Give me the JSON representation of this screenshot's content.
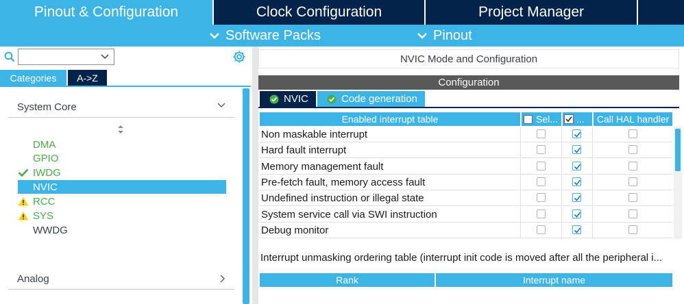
{
  "top_tabs": [
    {
      "label": "Pinout & Configuration",
      "active": true
    },
    {
      "label": "Clock Configuration",
      "active": false
    },
    {
      "label": "Project Manager",
      "active": false
    }
  ],
  "sub_menu": [
    {
      "label": "Software Packs"
    },
    {
      "label": "Pinout"
    }
  ],
  "left_panel": {
    "search_value": "",
    "category_tabs": [
      {
        "label": "Categories",
        "active": true
      },
      {
        "label": "A->Z",
        "active": false
      }
    ],
    "groups": [
      {
        "label": "System Core",
        "expanded": true
      },
      {
        "label": "Analog",
        "expanded": false
      }
    ],
    "peripherals": [
      {
        "label": "DMA",
        "status": "none",
        "color": "#45b046"
      },
      {
        "label": "GPIO",
        "status": "none",
        "color": "#45b046"
      },
      {
        "label": "IWDG",
        "status": "check",
        "color": "#45b046"
      },
      {
        "label": "NVIC",
        "status": "selected",
        "color": "#ffffff"
      },
      {
        "label": "RCC",
        "status": "warning",
        "color": "#45b046"
      },
      {
        "label": "SYS",
        "status": "warning",
        "color": "#45b046"
      },
      {
        "label": "WWDG",
        "status": "none",
        "color": "#39414a"
      }
    ]
  },
  "right_panel": {
    "mode_title": "NVIC Mode and Configuration",
    "config_header": "Configuration",
    "config_tabs": [
      {
        "label": "NVIC",
        "active": true
      },
      {
        "label": "Code generation",
        "active": false
      }
    ],
    "interrupt_table": {
      "headers": [
        "Enabled interrupt table",
        "Sel...",
        "...",
        "Call HAL handler"
      ],
      "rows": [
        {
          "name": "Non maskable interrupt",
          "sel": false,
          "enabled": true,
          "hal": false
        },
        {
          "name": "Hard fault interrupt",
          "sel": false,
          "enabled": true,
          "hal": false
        },
        {
          "name": "Memory management fault",
          "sel": false,
          "enabled": true,
          "hal": false
        },
        {
          "name": "Pre-fetch fault, memory access fault",
          "sel": false,
          "enabled": true,
          "hal": false
        },
        {
          "name": "Undefined instruction or illegal state",
          "sel": false,
          "enabled": true,
          "hal": false
        },
        {
          "name": "System service call via SWI instruction",
          "sel": false,
          "enabled": true,
          "hal": false
        },
        {
          "name": "Debug monitor",
          "sel": false,
          "enabled": true,
          "hal": false
        }
      ]
    },
    "unmask_text": "Interrupt unmasking ordering table (interrupt init code is moved after all the peripheral i...",
    "ordering_headers": [
      "Rank",
      "Interrupt name"
    ]
  },
  "colors": {
    "accent": "#3cb4e6",
    "navy": "#03234b",
    "green": "#45b046",
    "warning": "#ffd200",
    "config_bar": "#595959"
  }
}
